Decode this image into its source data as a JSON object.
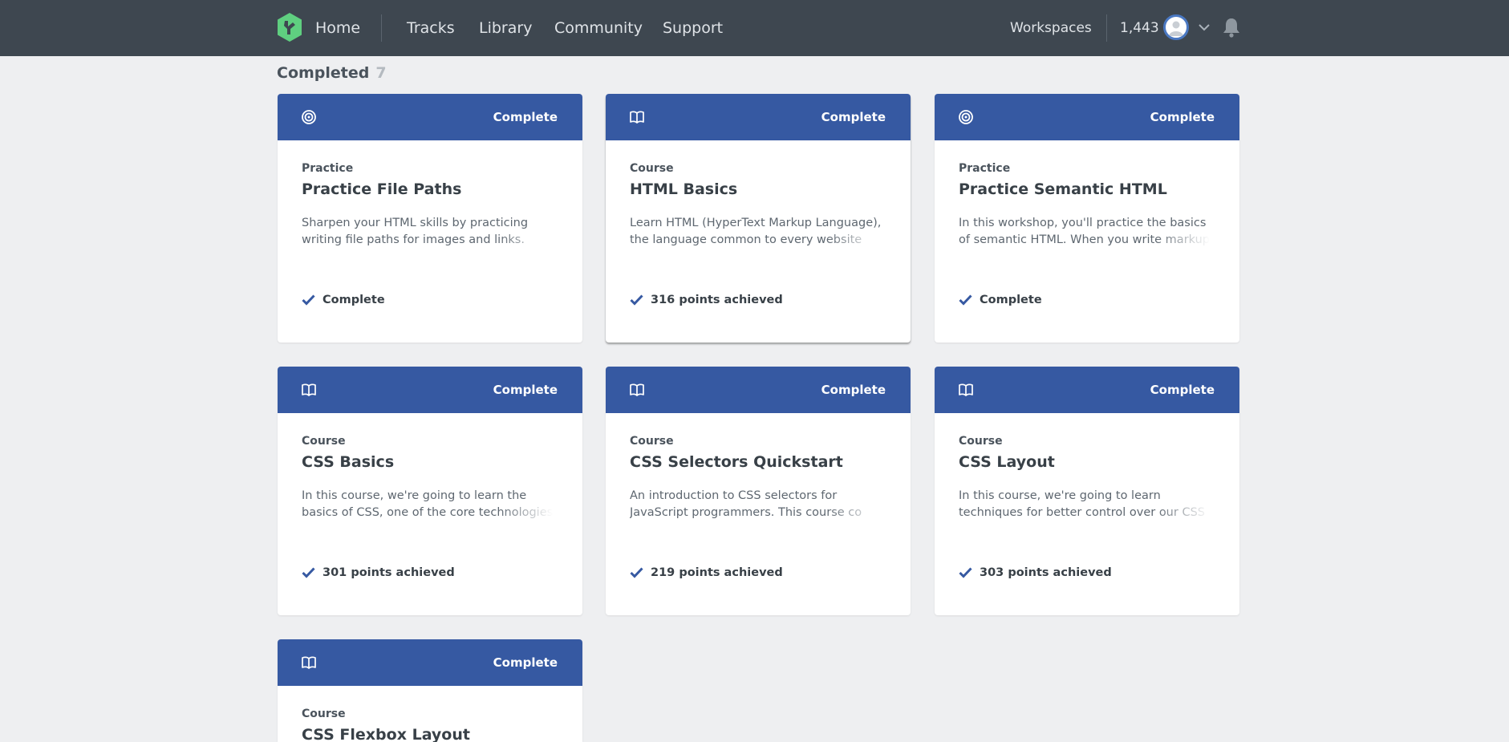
{
  "nav": {
    "home": "Home",
    "links": [
      "Tracks",
      "Library",
      "Community",
      "Support"
    ],
    "workspaces": "Workspaces",
    "points": "1,443",
    "icons": [
      "treehouse-logo-icon",
      "avatar-icon",
      "chevron-down-icon",
      "bell-icon"
    ]
  },
  "section": {
    "title": "Completed",
    "count": "7"
  },
  "colors": {
    "nav_bg": "#3e4750",
    "card_header": "#3659a2",
    "brand_green": "#5fcf80",
    "page_bg": "#eeeff1"
  },
  "cards": [
    {
      "icon": "target-icon",
      "status": "Complete",
      "type": "Practice",
      "title": "Practice File Paths",
      "description": "Sharpen your HTML skills by practicing writing file paths for images and links.",
      "footer": "Complete"
    },
    {
      "icon": "book-icon",
      "status": "Complete",
      "type": "Course",
      "title": "HTML Basics",
      "description": "Learn HTML (HyperText Markup Language), the language common to every website",
      "footer": "316 points achieved"
    },
    {
      "icon": "target-icon",
      "status": "Complete",
      "type": "Practice",
      "title": "Practice Semantic HTML",
      "description": "In this workshop, you'll practice the basics of semantic HTML. When you write markup",
      "footer": "Complete"
    },
    {
      "icon": "book-icon",
      "status": "Complete",
      "type": "Course",
      "title": "CSS Basics",
      "description": "In this course, we're going to learn the basics of CSS, one of the core technologies for",
      "footer": "301 points achieved"
    },
    {
      "icon": "book-icon",
      "status": "Complete",
      "type": "Course",
      "title": "CSS Selectors Quickstart",
      "description": "An introduction to CSS selectors for JavaScript programmers. This course co",
      "footer": "219 points achieved"
    },
    {
      "icon": "book-icon",
      "status": "Complete",
      "type": "Course",
      "title": "CSS Layout",
      "description": "In this course, we're going to learn techniques for better control over our CSS layouts.",
      "footer": "303 points achieved"
    },
    {
      "icon": "book-icon",
      "status": "Complete",
      "type": "Course",
      "title": "CSS Flexbox Layout",
      "description": "",
      "footer": ""
    }
  ]
}
